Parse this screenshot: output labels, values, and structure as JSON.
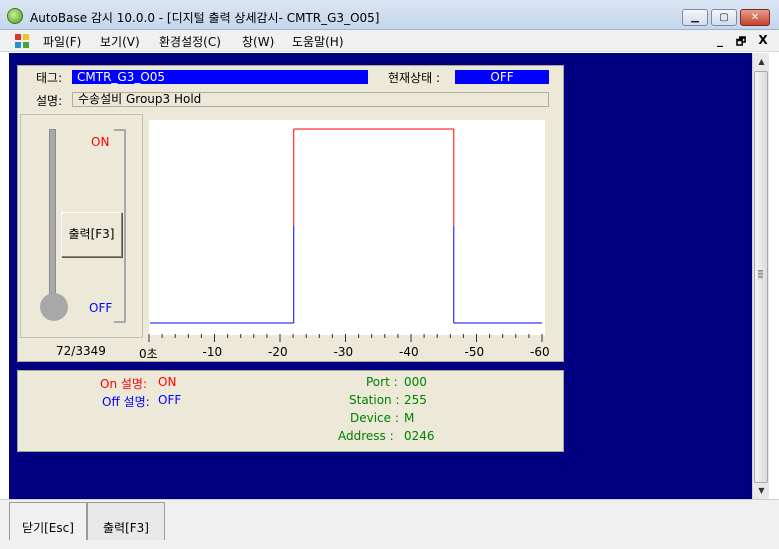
{
  "window": {
    "title": "AutoBase 감시 10.0.0 - [디지털 출력 상세감시- CMTR_G3_O05]",
    "minimize_glyph": "▁",
    "maximize_glyph": "▢",
    "close_glyph": "✕"
  },
  "menu": {
    "items": [
      "파일(F)",
      "보기(V)",
      "환경설정(C)",
      "창(W)",
      "도움말(H)"
    ],
    "mdi_min": "_",
    "mdi_restore": "🗗",
    "mdi_close": "X"
  },
  "info": {
    "tag_label": "태그:",
    "tag_value": "CMTR_G3_O05",
    "status_label": "현재상태 :",
    "status_value": "OFF",
    "desc_label": "설명:",
    "desc_value": "수송설비 Group3 Hold"
  },
  "control": {
    "on_label": "ON",
    "off_label": "OFF",
    "output_button": "출력[F3]",
    "counter": "72/3349"
  },
  "chart_data": {
    "type": "line",
    "title": "",
    "xlabel": "",
    "ylabel": "",
    "x_ticks": [
      "0초",
      "-10",
      "-20",
      "-30",
      "-40",
      "-50",
      "-60"
    ],
    "xlim": [
      0,
      -60
    ],
    "ylim": [
      "OFF",
      "ON"
    ],
    "series": [
      {
        "color": "#ff0000",
        "x": [
          0,
          -22,
          -22,
          -46.5,
          -46.5,
          -60
        ],
        "y": [
          0,
          0,
          1,
          1,
          0,
          0
        ]
      }
    ],
    "off_color": "#0000ff",
    "on_color": "#ff0000"
  },
  "details": {
    "on_desc_label": "On 설명:",
    "on_desc_value": "ON",
    "off_desc_label": "Off 설명:",
    "off_desc_value": "OFF",
    "port_label": "Port :",
    "port_value": "000",
    "station_label": "Station :",
    "station_value": "255",
    "device_label": "Device :",
    "device_value": "M",
    "address_label": "Address :",
    "address_value": "0246"
  },
  "bottom": {
    "close_button": "닫기[Esc]",
    "output_button": "출력[F3]"
  }
}
